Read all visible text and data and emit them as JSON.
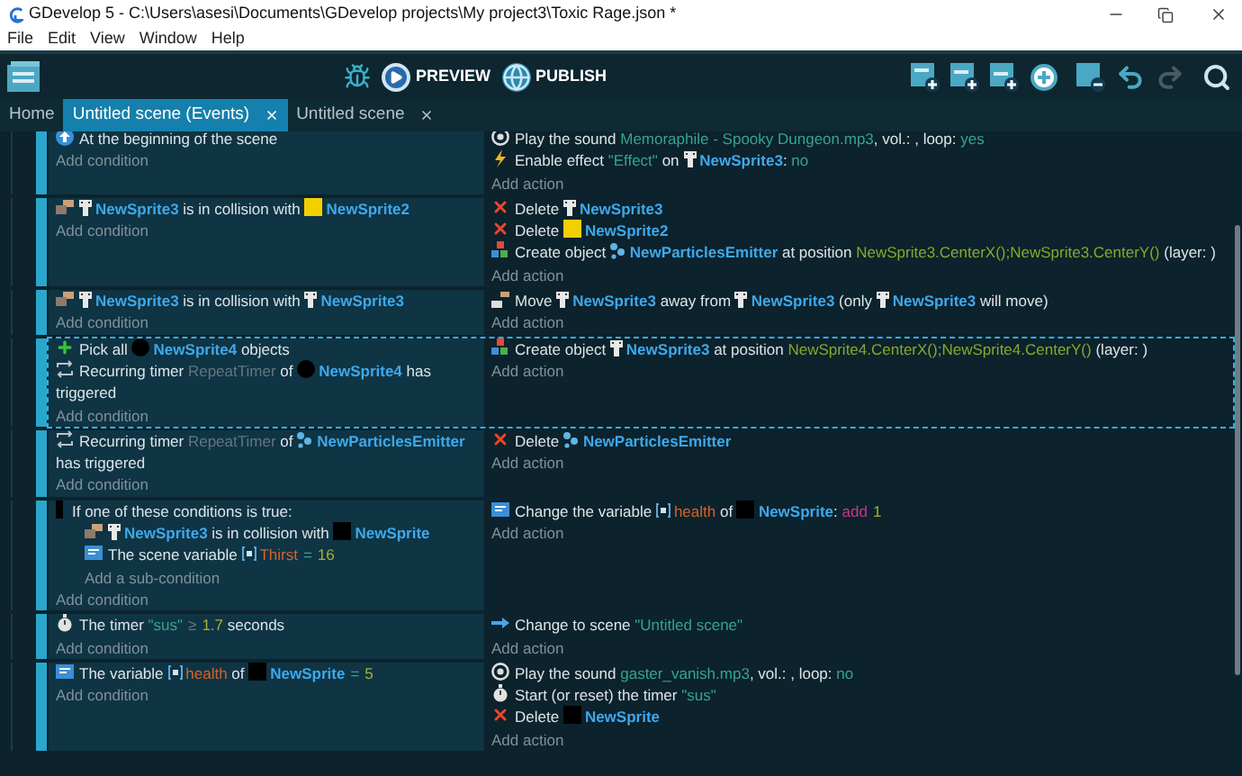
{
  "window": {
    "title": "GDevelop 5 - C:\\Users\\asesi\\Documents\\GDevelop projects\\My project3\\Toxic Rage.json *"
  },
  "menu": [
    "File",
    "Edit",
    "View",
    "Window",
    "Help"
  ],
  "toolbar": {
    "preview": "PREVIEW",
    "publish": "PUBLISH",
    "redo": {
      "disabled": true
    }
  },
  "tabs": [
    {
      "label": "Home",
      "selected": false,
      "closable": false
    },
    {
      "label": "Untitled scene (Events)",
      "selected": true,
      "closable": true
    },
    {
      "label": "Untitled scene",
      "selected": false,
      "closable": true
    }
  ],
  "events": [
    {
      "selected": false,
      "add_condition": "Add condition",
      "add_action": "Add action",
      "conditions": [
        {
          "kind": "start",
          "segments": [
            {
              "kind": "text",
              "text": "At the beginning of the scene"
            }
          ]
        }
      ],
      "actions": [
        {
          "kind": "sound",
          "segments": [
            {
              "kind": "text",
              "text": "Play the sound "
            },
            {
              "kind": "string",
              "text": "Memoraphile - Spooky Dungeon.mp3"
            },
            {
              "kind": "text",
              "text": ", vol.: , loop: "
            },
            {
              "kind": "string",
              "text": "yes"
            }
          ]
        },
        {
          "kind": "effect",
          "segments": [
            {
              "kind": "text",
              "text": "Enable effect "
            },
            {
              "kind": "string",
              "text": "\"Effect\""
            },
            {
              "kind": "text",
              "text": " on "
            },
            {
              "kind": "sprite-object",
              "text": "NewSprite3"
            },
            {
              "kind": "text",
              "text": ": "
            },
            {
              "kind": "string",
              "text": "no"
            }
          ]
        }
      ]
    },
    {
      "selected": false,
      "add_condition": "Add condition",
      "add_action": "Add action",
      "conditions": [
        {
          "kind": "collision",
          "segments": [
            {
              "kind": "sprite-object",
              "text": "NewSprite3"
            },
            {
              "kind": "text",
              "text": " is in collision with "
            },
            {
              "kind": "square-object",
              "color": "#f2d000",
              "text": "NewSprite2"
            }
          ]
        }
      ],
      "actions": [
        {
          "kind": "delete",
          "segments": [
            {
              "kind": "text",
              "text": "Delete "
            },
            {
              "kind": "sprite-object",
              "text": "NewSprite3"
            }
          ]
        },
        {
          "kind": "delete",
          "segments": [
            {
              "kind": "text",
              "text": "Delete "
            },
            {
              "kind": "square-object",
              "color": "#f2d000",
              "text": "NewSprite2"
            }
          ]
        },
        {
          "kind": "create",
          "segments": [
            {
              "kind": "text",
              "text": "Create object "
            },
            {
              "kind": "particles-object",
              "text": "NewParticlesEmitter"
            },
            {
              "kind": "text",
              "text": " at position "
            },
            {
              "kind": "expression",
              "text": "NewSprite3.CenterX();NewSprite3.CenterY()"
            },
            {
              "kind": "text",
              "text": " (layer: )"
            }
          ]
        }
      ]
    },
    {
      "selected": false,
      "add_condition": "Add condition",
      "add_action": "Add action",
      "conditions": [
        {
          "kind": "collision",
          "segments": [
            {
              "kind": "sprite-object",
              "text": "NewSprite3"
            },
            {
              "kind": "text",
              "text": " is in collision with "
            },
            {
              "kind": "sprite-object",
              "text": "NewSprite3"
            }
          ]
        }
      ],
      "actions": [
        {
          "kind": "move",
          "segments": [
            {
              "kind": "text",
              "text": "Move "
            },
            {
              "kind": "sprite-object",
              "text": "NewSprite3"
            },
            {
              "kind": "text",
              "text": " away from "
            },
            {
              "kind": "sprite-object",
              "text": "NewSprite3"
            },
            {
              "kind": "text",
              "text": " (only "
            },
            {
              "kind": "sprite-object",
              "text": "NewSprite3"
            },
            {
              "kind": "text",
              "text": " will move)"
            }
          ]
        }
      ]
    },
    {
      "selected": true,
      "add_condition": "Add condition",
      "add_action": "Add action",
      "conditions": [
        {
          "kind": "pick",
          "segments": [
            {
              "kind": "text",
              "text": "Pick all "
            },
            {
              "kind": "circle-object",
              "color": "#000000",
              "text": "NewSprite4"
            },
            {
              "kind": "text",
              "text": " objects"
            }
          ]
        },
        {
          "kind": "repeat",
          "segments": [
            {
              "kind": "text",
              "text": "Recurring timer "
            },
            {
              "kind": "param",
              "text": "RepeatTimer"
            },
            {
              "kind": "text",
              "text": " of "
            },
            {
              "kind": "circle-object",
              "color": "#000000",
              "text": "NewSprite4"
            },
            {
              "kind": "text",
              "text": " has "
            },
            {
              "kind": "text",
              "text": "triggered"
            }
          ]
        }
      ],
      "actions": [
        {
          "kind": "create",
          "segments": [
            {
              "kind": "text",
              "text": "Create object "
            },
            {
              "kind": "sprite-object",
              "text": "NewSprite3"
            },
            {
              "kind": "text",
              "text": " at position "
            },
            {
              "kind": "expression",
              "text": "NewSprite4.CenterX();NewSprite4.CenterY()"
            },
            {
              "kind": "text",
              "text": " (layer: )"
            }
          ]
        }
      ]
    },
    {
      "selected": false,
      "add_condition": "Add condition",
      "add_action": "Add action",
      "conditions": [
        {
          "kind": "repeat",
          "segments": [
            {
              "kind": "text",
              "text": "Recurring timer "
            },
            {
              "kind": "param",
              "text": "RepeatTimer"
            },
            {
              "kind": "text",
              "text": " of "
            },
            {
              "kind": "particles-object",
              "text": "NewParticlesEmitter"
            },
            {
              "kind": "line-text",
              "text": "has triggered"
            }
          ]
        }
      ],
      "actions": [
        {
          "kind": "delete",
          "segments": [
            {
              "kind": "text",
              "text": "Delete "
            },
            {
              "kind": "particles-object",
              "text": "NewParticlesEmitter"
            }
          ]
        }
      ]
    },
    {
      "selected": false,
      "add_condition": "Add condition",
      "add_action": "Add action",
      "conditions": [
        {
          "kind": "or",
          "segments": [
            {
              "kind": "text",
              "text": "If one of these conditions is true:"
            }
          ],
          "add_sub_condition": "Add a sub-condition",
          "children": [
            {
              "kind": "collision",
              "segments": [
                {
                  "kind": "sprite-object",
                  "text": "NewSprite3"
                },
                {
                  "kind": "text",
                  "text": " is in collision with "
                },
                {
                  "kind": "square-object",
                  "color": "#000000",
                  "text": "NewSprite"
                }
              ]
            },
            {
              "kind": "variable",
              "segments": [
                {
                  "kind": "text",
                  "text": "The scene variable "
                },
                {
                  "kind": "variable",
                  "text": "Thirst"
                },
                {
                  "kind": "operator",
                  "text": "="
                },
                {
                  "kind": "number",
                  "text": "16"
                }
              ]
            }
          ]
        }
      ],
      "actions": [
        {
          "kind": "variable",
          "segments": [
            {
              "kind": "text",
              "text": "Change the variable "
            },
            {
              "kind": "variable",
              "text": "health"
            },
            {
              "kind": "text",
              "text": " of "
            },
            {
              "kind": "square-object",
              "color": "#000000",
              "text": "NewSprite"
            },
            {
              "kind": "text",
              "text": ": "
            },
            {
              "kind": "operation",
              "text": "add"
            },
            {
              "kind": "number",
              "text": "1"
            }
          ]
        }
      ]
    },
    {
      "selected": false,
      "add_condition": "Add condition",
      "add_action": "Add action",
      "conditions": [
        {
          "kind": "timer",
          "segments": [
            {
              "kind": "text",
              "text": "The timer "
            },
            {
              "kind": "string",
              "text": "\"sus\""
            },
            {
              "kind": "param-operator",
              "text": "≥"
            },
            {
              "kind": "number",
              "text": "1.7"
            },
            {
              "kind": "text",
              "text": " seconds"
            }
          ]
        }
      ],
      "actions": [
        {
          "kind": "scene",
          "segments": [
            {
              "kind": "text",
              "text": "Change to scene "
            },
            {
              "kind": "string",
              "text": "\"Untitled scene\""
            }
          ]
        }
      ]
    },
    {
      "selected": false,
      "add_condition": "Add condition",
      "add_action": "Add action",
      "conditions": [
        {
          "kind": "variable",
          "segments": [
            {
              "kind": "text",
              "text": "The variable "
            },
            {
              "kind": "variable",
              "text": "health"
            },
            {
              "kind": "text",
              "text": " of "
            },
            {
              "kind": "square-object",
              "color": "#000000",
              "text": "NewSprite"
            },
            {
              "kind": "operator",
              "text": "="
            },
            {
              "kind": "number",
              "text": "5"
            }
          ]
        }
      ],
      "actions": [
        {
          "kind": "sound",
          "segments": [
            {
              "kind": "text",
              "text": "Play the sound "
            },
            {
              "kind": "string",
              "text": "gaster_vanish.mp3"
            },
            {
              "kind": "text",
              "text": ", vol.: , loop: "
            },
            {
              "kind": "string",
              "text": "no"
            }
          ]
        },
        {
          "kind": "timer",
          "segments": [
            {
              "kind": "text",
              "text": "Start (or reset) the timer "
            },
            {
              "kind": "string",
              "text": "\"sus\""
            }
          ]
        },
        {
          "kind": "delete",
          "segments": [
            {
              "kind": "text",
              "text": "Delete "
            },
            {
              "kind": "square-object",
              "color": "#000000",
              "text": "NewSprite"
            }
          ]
        }
      ]
    }
  ]
}
